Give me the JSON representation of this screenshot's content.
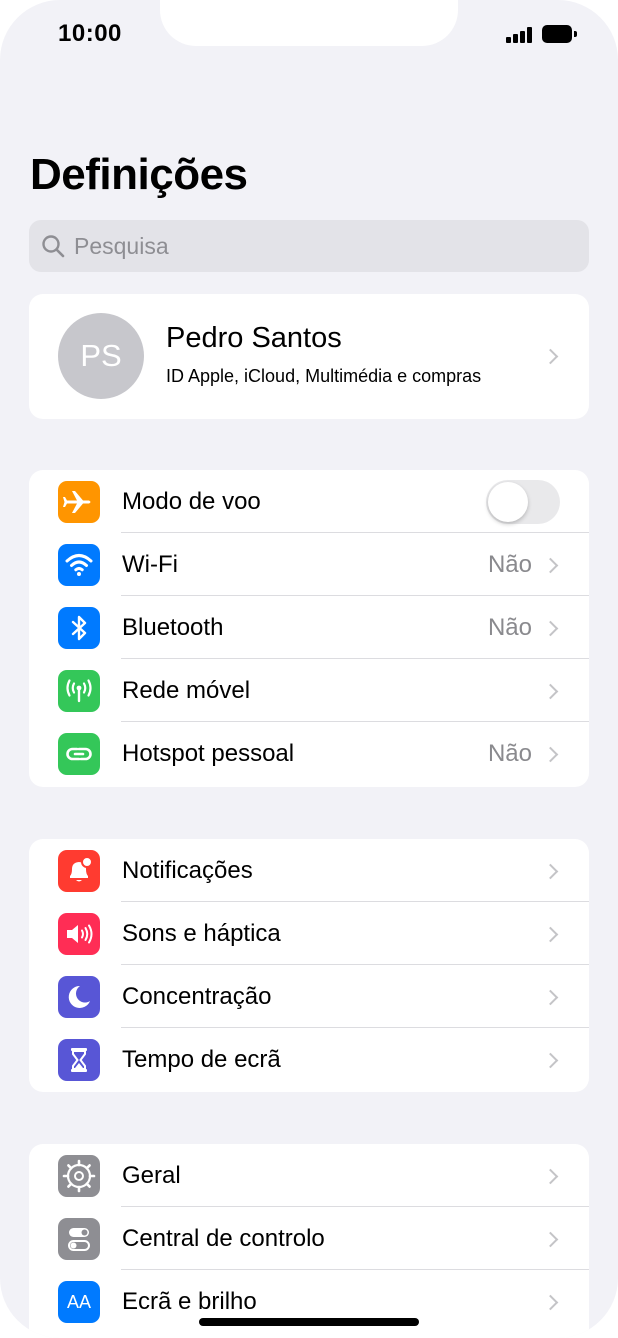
{
  "status_bar": {
    "time": "10:00"
  },
  "page_title": "Definições",
  "search": {
    "placeholder": "Pesquisa"
  },
  "profile": {
    "initials": "PS",
    "name": "Pedro Santos",
    "subtitle": "ID Apple, iCloud, Multimédia e compras"
  },
  "groups": [
    {
      "rows": [
        {
          "label": "Modo de voo",
          "icon": "airplane-icon",
          "color": "#ff9500",
          "toggle": false
        },
        {
          "label": "Wi-Fi",
          "icon": "wifi-icon",
          "color": "#007aff",
          "value": "Não"
        },
        {
          "label": "Bluetooth",
          "icon": "bluetooth-icon",
          "color": "#007aff",
          "value": "Não"
        },
        {
          "label": "Rede móvel",
          "icon": "antenna-icon",
          "color": "#34c759"
        },
        {
          "label": "Hotspot pessoal",
          "icon": "hotspot-icon",
          "color": "#34c759",
          "value": "Não"
        }
      ]
    },
    {
      "rows": [
        {
          "label": "Notificações",
          "icon": "notification-bell-icon",
          "color": "#ff3b30"
        },
        {
          "label": "Sons e háptica",
          "icon": "speaker-icon",
          "color": "#ff2d55"
        },
        {
          "label": "Concentração",
          "icon": "moon-icon",
          "color": "#5856d6"
        },
        {
          "label": "Tempo de ecrã",
          "icon": "hourglass-icon",
          "color": "#5856d6"
        }
      ]
    },
    {
      "rows": [
        {
          "label": "Geral",
          "icon": "gear-icon",
          "color": "#8e8e93"
        },
        {
          "label": "Central de controlo",
          "icon": "toggles-icon",
          "color": "#8e8e93"
        },
        {
          "label": "Ecrã e brilho",
          "icon": "text-size-icon",
          "color": "#007aff",
          "icon_text": "AA"
        }
      ]
    }
  ]
}
